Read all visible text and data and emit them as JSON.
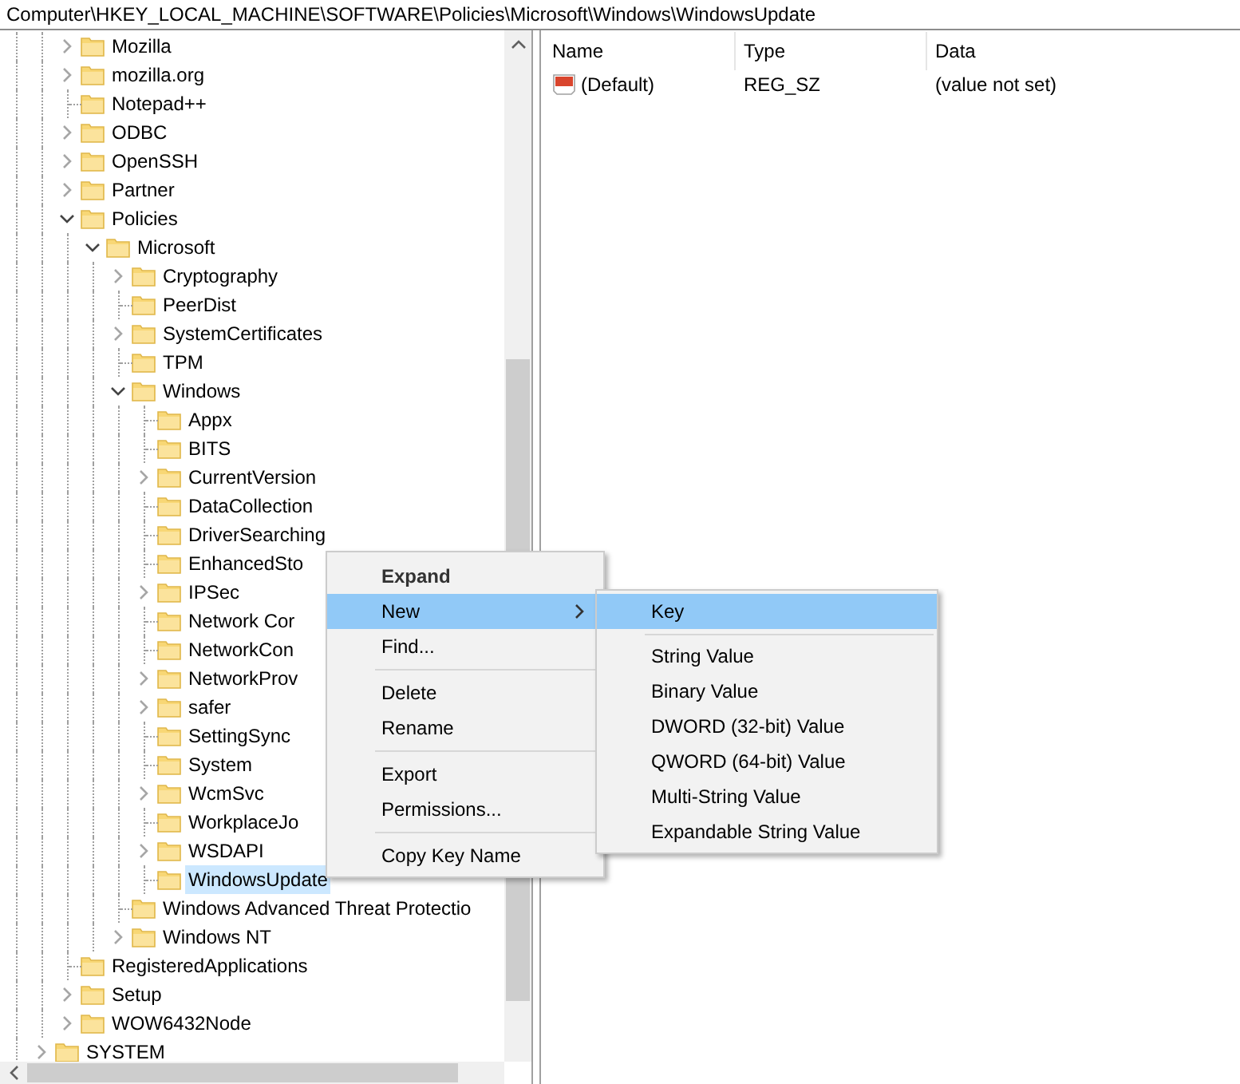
{
  "address_bar": {
    "path": "Computer\\HKEY_LOCAL_MACHINE\\SOFTWARE\\Policies\\Microsoft\\Windows\\WindowsUpdate"
  },
  "tree": [
    {
      "children": [
        {
          "label": "Mozilla",
          "kind": "collapsed",
          "selected": false
        },
        {
          "label": "mozilla.org",
          "kind": "collapsed",
          "selected": false
        },
        {
          "label": "Notepad++",
          "kind": "leaf",
          "selected": false
        },
        {
          "label": "ODBC",
          "kind": "collapsed",
          "selected": false
        },
        {
          "label": "OpenSSH",
          "kind": "collapsed",
          "selected": false
        },
        {
          "label": "Partner",
          "kind": "collapsed",
          "selected": false
        },
        {
          "label": "Policies",
          "kind": "expanded",
          "selected": false,
          "children": [
            {
              "label": "Microsoft",
              "kind": "expanded",
              "selected": false,
              "children": [
                {
                  "label": "Cryptography",
                  "kind": "collapsed",
                  "selected": false
                },
                {
                  "label": "PeerDist",
                  "kind": "leaf",
                  "selected": false
                },
                {
                  "label": "SystemCertificates",
                  "kind": "collapsed",
                  "selected": false
                },
                {
                  "label": "TPM",
                  "kind": "leaf",
                  "selected": false
                },
                {
                  "label": "Windows",
                  "kind": "expanded",
                  "selected": false,
                  "children": [
                    {
                      "label": "Appx",
                      "kind": "leaf",
                      "selected": false
                    },
                    {
                      "label": "BITS",
                      "kind": "leaf",
                      "selected": false
                    },
                    {
                      "label": "CurrentVersion",
                      "kind": "collapsed",
                      "selected": false
                    },
                    {
                      "label": "DataCollection",
                      "kind": "leaf",
                      "selected": false
                    },
                    {
                      "label": "DriverSearching",
                      "kind": "leaf",
                      "selected": false
                    },
                    {
                      "label": "EnhancedSto",
                      "kind": "leaf",
                      "selected": false
                    },
                    {
                      "label": "IPSec",
                      "kind": "collapsed",
                      "selected": false
                    },
                    {
                      "label": "Network Cor",
                      "kind": "leaf",
                      "selected": false
                    },
                    {
                      "label": "NetworkCon",
                      "kind": "leaf",
                      "selected": false
                    },
                    {
                      "label": "NetworkProv",
                      "kind": "collapsed",
                      "selected": false
                    },
                    {
                      "label": "safer",
                      "kind": "collapsed",
                      "selected": false
                    },
                    {
                      "label": "SettingSync",
                      "kind": "leaf",
                      "selected": false
                    },
                    {
                      "label": "System",
                      "kind": "leaf",
                      "selected": false
                    },
                    {
                      "label": "WcmSvc",
                      "kind": "collapsed",
                      "selected": false
                    },
                    {
                      "label": "WorkplaceJo",
                      "kind": "leaf",
                      "selected": false
                    },
                    {
                      "label": "WSDAPI",
                      "kind": "collapsed",
                      "selected": false
                    },
                    {
                      "label": "WindowsUpdate",
                      "kind": "leaf",
                      "selected": true
                    }
                  ]
                },
                {
                  "label": "Windows Advanced Threat Protectio",
                  "kind": "leaf",
                  "selected": false
                },
                {
                  "label": "Windows NT",
                  "kind": "collapsed",
                  "selected": false
                }
              ]
            }
          ]
        },
        {
          "label": "RegisteredApplications",
          "kind": "leaf",
          "selected": false
        },
        {
          "label": "Setup",
          "kind": "collapsed",
          "selected": false
        },
        {
          "label": "WOW6432Node",
          "kind": "collapsed",
          "selected": false
        }
      ]
    },
    {
      "label": "SYSTEM",
      "kind": "collapsed",
      "selected": false
    }
  ],
  "values": {
    "columns": [
      "Name",
      "Type",
      "Data"
    ],
    "rows": [
      {
        "name": "(Default)",
        "type": "REG_SZ",
        "data": "(value not set)"
      }
    ]
  },
  "context_menu": {
    "items": [
      {
        "kind": "default",
        "label": "Expand",
        "selected": false
      },
      {
        "kind": "submenu",
        "label": "New",
        "selected": true
      },
      {
        "kind": "item",
        "label": "Find...",
        "selected": false
      },
      {
        "kind": "separator"
      },
      {
        "kind": "item",
        "label": "Delete",
        "selected": false
      },
      {
        "kind": "item",
        "label": "Rename",
        "selected": false
      },
      {
        "kind": "separator"
      },
      {
        "kind": "item",
        "label": "Export",
        "selected": false
      },
      {
        "kind": "item",
        "label": "Permissions...",
        "selected": false
      },
      {
        "kind": "separator"
      },
      {
        "kind": "item",
        "label": "Copy Key Name",
        "selected": false
      }
    ]
  },
  "submenu": {
    "items": [
      {
        "kind": "item",
        "label": "Key",
        "selected": true
      },
      {
        "kind": "separator"
      },
      {
        "kind": "item",
        "label": "String Value",
        "selected": false
      },
      {
        "kind": "item",
        "label": "Binary Value",
        "selected": false
      },
      {
        "kind": "item",
        "label": "DWORD (32-bit) Value",
        "selected": false
      },
      {
        "kind": "item",
        "label": "QWORD (64-bit) Value",
        "selected": false
      },
      {
        "kind": "item",
        "label": "Multi-String Value",
        "selected": false
      },
      {
        "kind": "item",
        "label": "Expandable String Value",
        "selected": false
      }
    ]
  }
}
